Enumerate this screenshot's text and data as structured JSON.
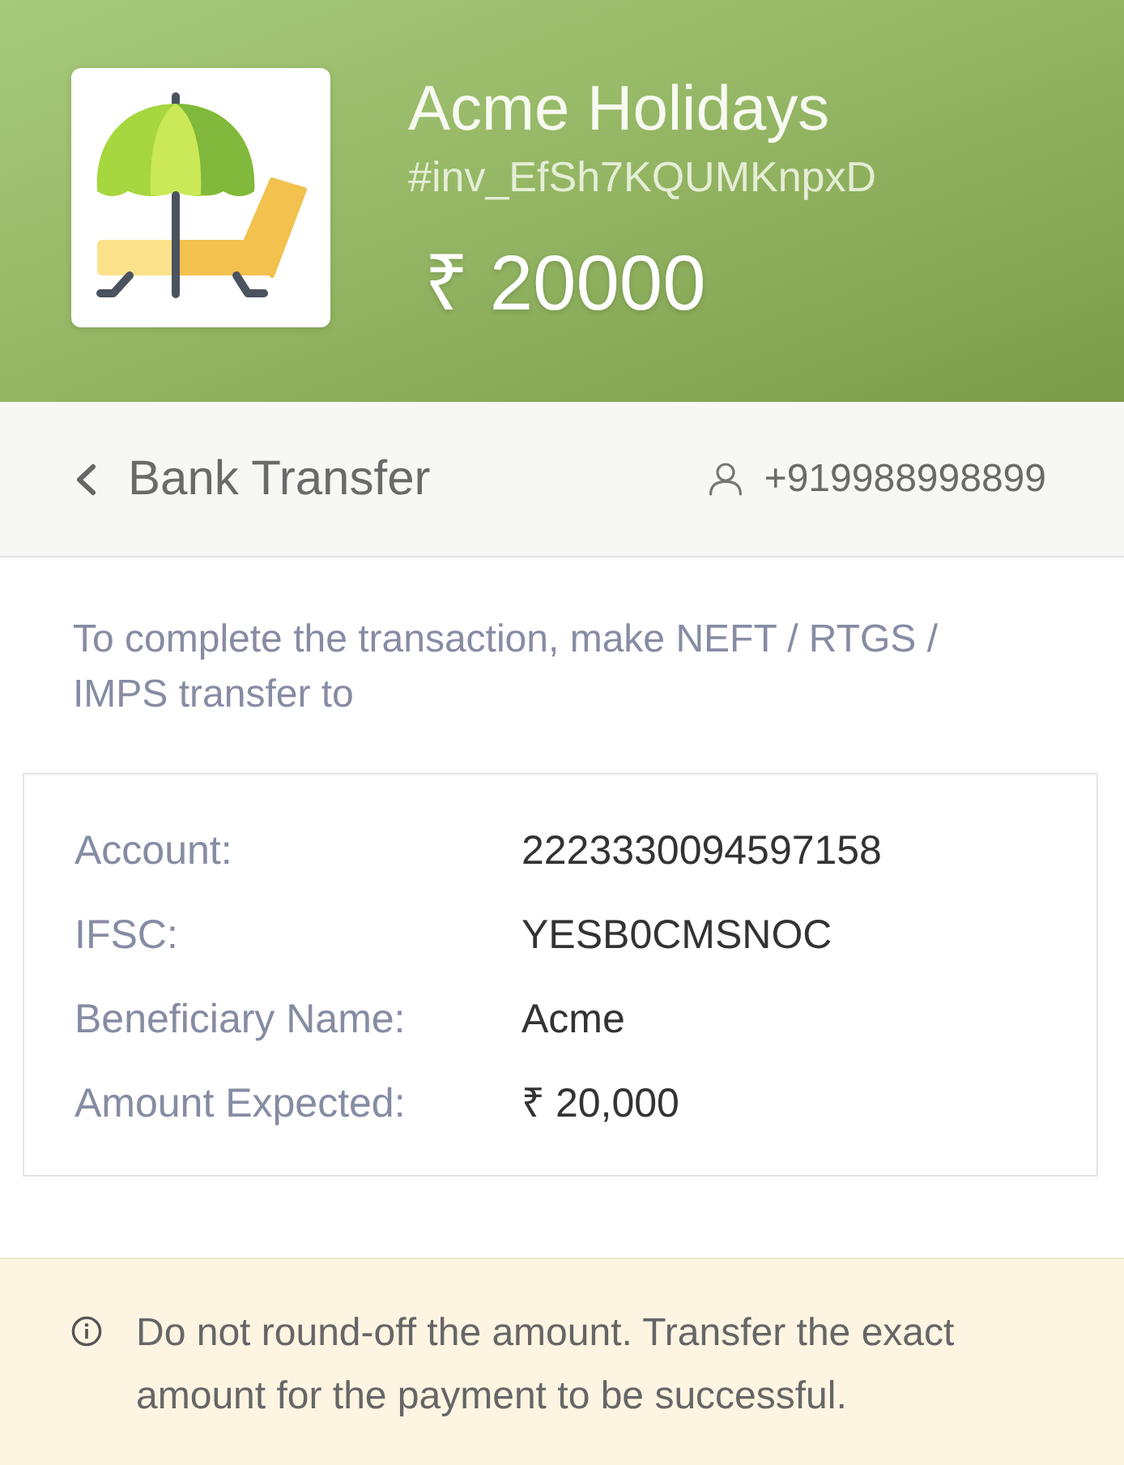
{
  "header": {
    "merchant": "Acme Holidays",
    "invoice_id": "#inv_EfSh7KQUMKnpxD",
    "amount": "₹ 20000"
  },
  "nav": {
    "title": "Bank Transfer",
    "contact": "+919988998899"
  },
  "instructions": "To complete the transaction, make NEFT / RTGS / IMPS transfer to",
  "details": [
    {
      "label": "Account:",
      "value": "2223330094597158"
    },
    {
      "label": "IFSC:",
      "value": "YESB0CMSNOC"
    },
    {
      "label": "Beneficiary Name:",
      "value": "Acme"
    },
    {
      "label": "Amount Expected:",
      "value": "₹ 20,000"
    }
  ],
  "notice": "Do not round-off the amount. Transfer the exact amount for the payment to be successful."
}
